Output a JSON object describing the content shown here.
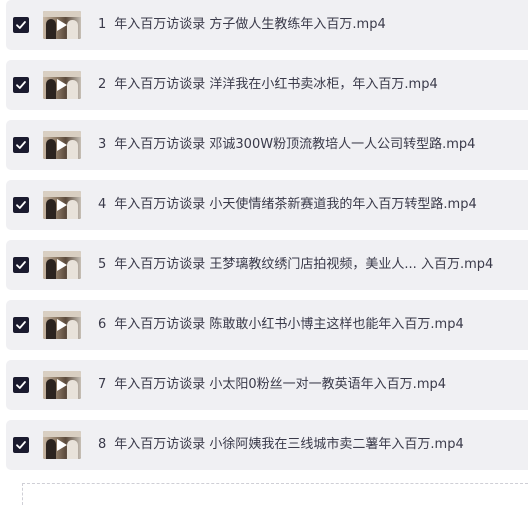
{
  "files": [
    {
      "num": "1",
      "name": "年入百万访谈录  方子做人生教练年入百万.mp4",
      "checked": true
    },
    {
      "num": "2",
      "name": "年入百万访谈录  洋洋我在小红书卖冰柜，年入百万.mp4",
      "checked": true
    },
    {
      "num": "3",
      "name": "年入百万访谈录  邓诚300W粉顶流教培人一人公司转型路.mp4",
      "checked": true
    },
    {
      "num": "4",
      "name": "年入百万访谈录  小天使情绪茶新赛道我的年入百万转型路.mp4",
      "checked": true
    },
    {
      "num": "5",
      "name": "年入百万访谈录  王梦璃教纹绣门店拍视频，美业人... 入百万.mp4",
      "checked": true
    },
    {
      "num": "6",
      "name": "年入百万访谈录  陈敢敢小红书小博主这样也能年入百万.mp4",
      "checked": true
    },
    {
      "num": "7",
      "name": "年入百万访谈录  小太阳0粉丝一对一教英语年入百万.mp4",
      "checked": true
    },
    {
      "num": "8",
      "name": "年入百万访谈录  小徐阿姨我在三线城市卖二薯年入百万.mp4",
      "checked": true
    }
  ],
  "icons": {
    "checkbox": "checkmark-icon",
    "thumbnail": "video-thumbnail",
    "play": "play-icon"
  },
  "colors": {
    "row_bg": "#f0f0f3",
    "checkbox_bg": "#1a1a2e",
    "text": "#3a3a4a"
  }
}
